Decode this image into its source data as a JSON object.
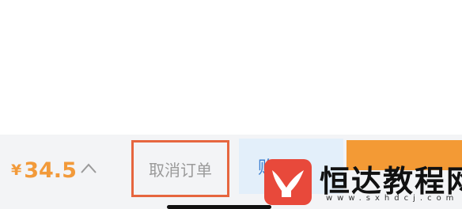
{
  "footer": {
    "currency": "¥",
    "price": "34.5",
    "cancel_label": "取消订单",
    "secondary_label": "购",
    "primary_label": ""
  },
  "watermark": {
    "title": "恒达教程网",
    "url": "www.sxhdcj.com"
  },
  "colors": {
    "accent_orange": "#f39a35",
    "highlight_red": "#e6663f",
    "logo_red": "#e8493b",
    "secondary_bg": "#e3effa",
    "bar_bg": "#f3f4f6"
  },
  "icons": {
    "expand": "chevron-up-icon",
    "logo": "whale-tail-logo"
  }
}
